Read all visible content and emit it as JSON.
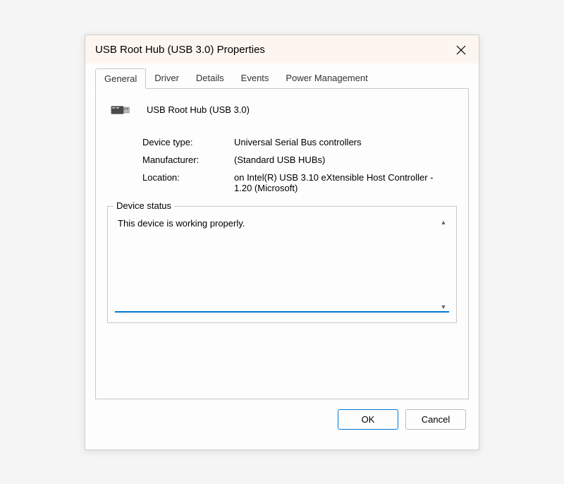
{
  "window": {
    "title": "USB Root Hub (USB 3.0) Properties"
  },
  "tabs": [
    {
      "label": "General",
      "active": true
    },
    {
      "label": "Driver",
      "active": false
    },
    {
      "label": "Details",
      "active": false
    },
    {
      "label": "Events",
      "active": false
    },
    {
      "label": "Power Management",
      "active": false
    }
  ],
  "device": {
    "name": "USB Root Hub (USB 3.0)",
    "type_label": "Device type:",
    "type_value": "Universal Serial Bus controllers",
    "manufacturer_label": "Manufacturer:",
    "manufacturer_value": "(Standard USB HUBs)",
    "location_label": "Location:",
    "location_value": "on Intel(R) USB 3.10 eXtensible Host Controller - 1.20 (Microsoft)"
  },
  "status": {
    "legend": "Device status",
    "text": "This device is working properly."
  },
  "buttons": {
    "ok": "OK",
    "cancel": "Cancel"
  }
}
